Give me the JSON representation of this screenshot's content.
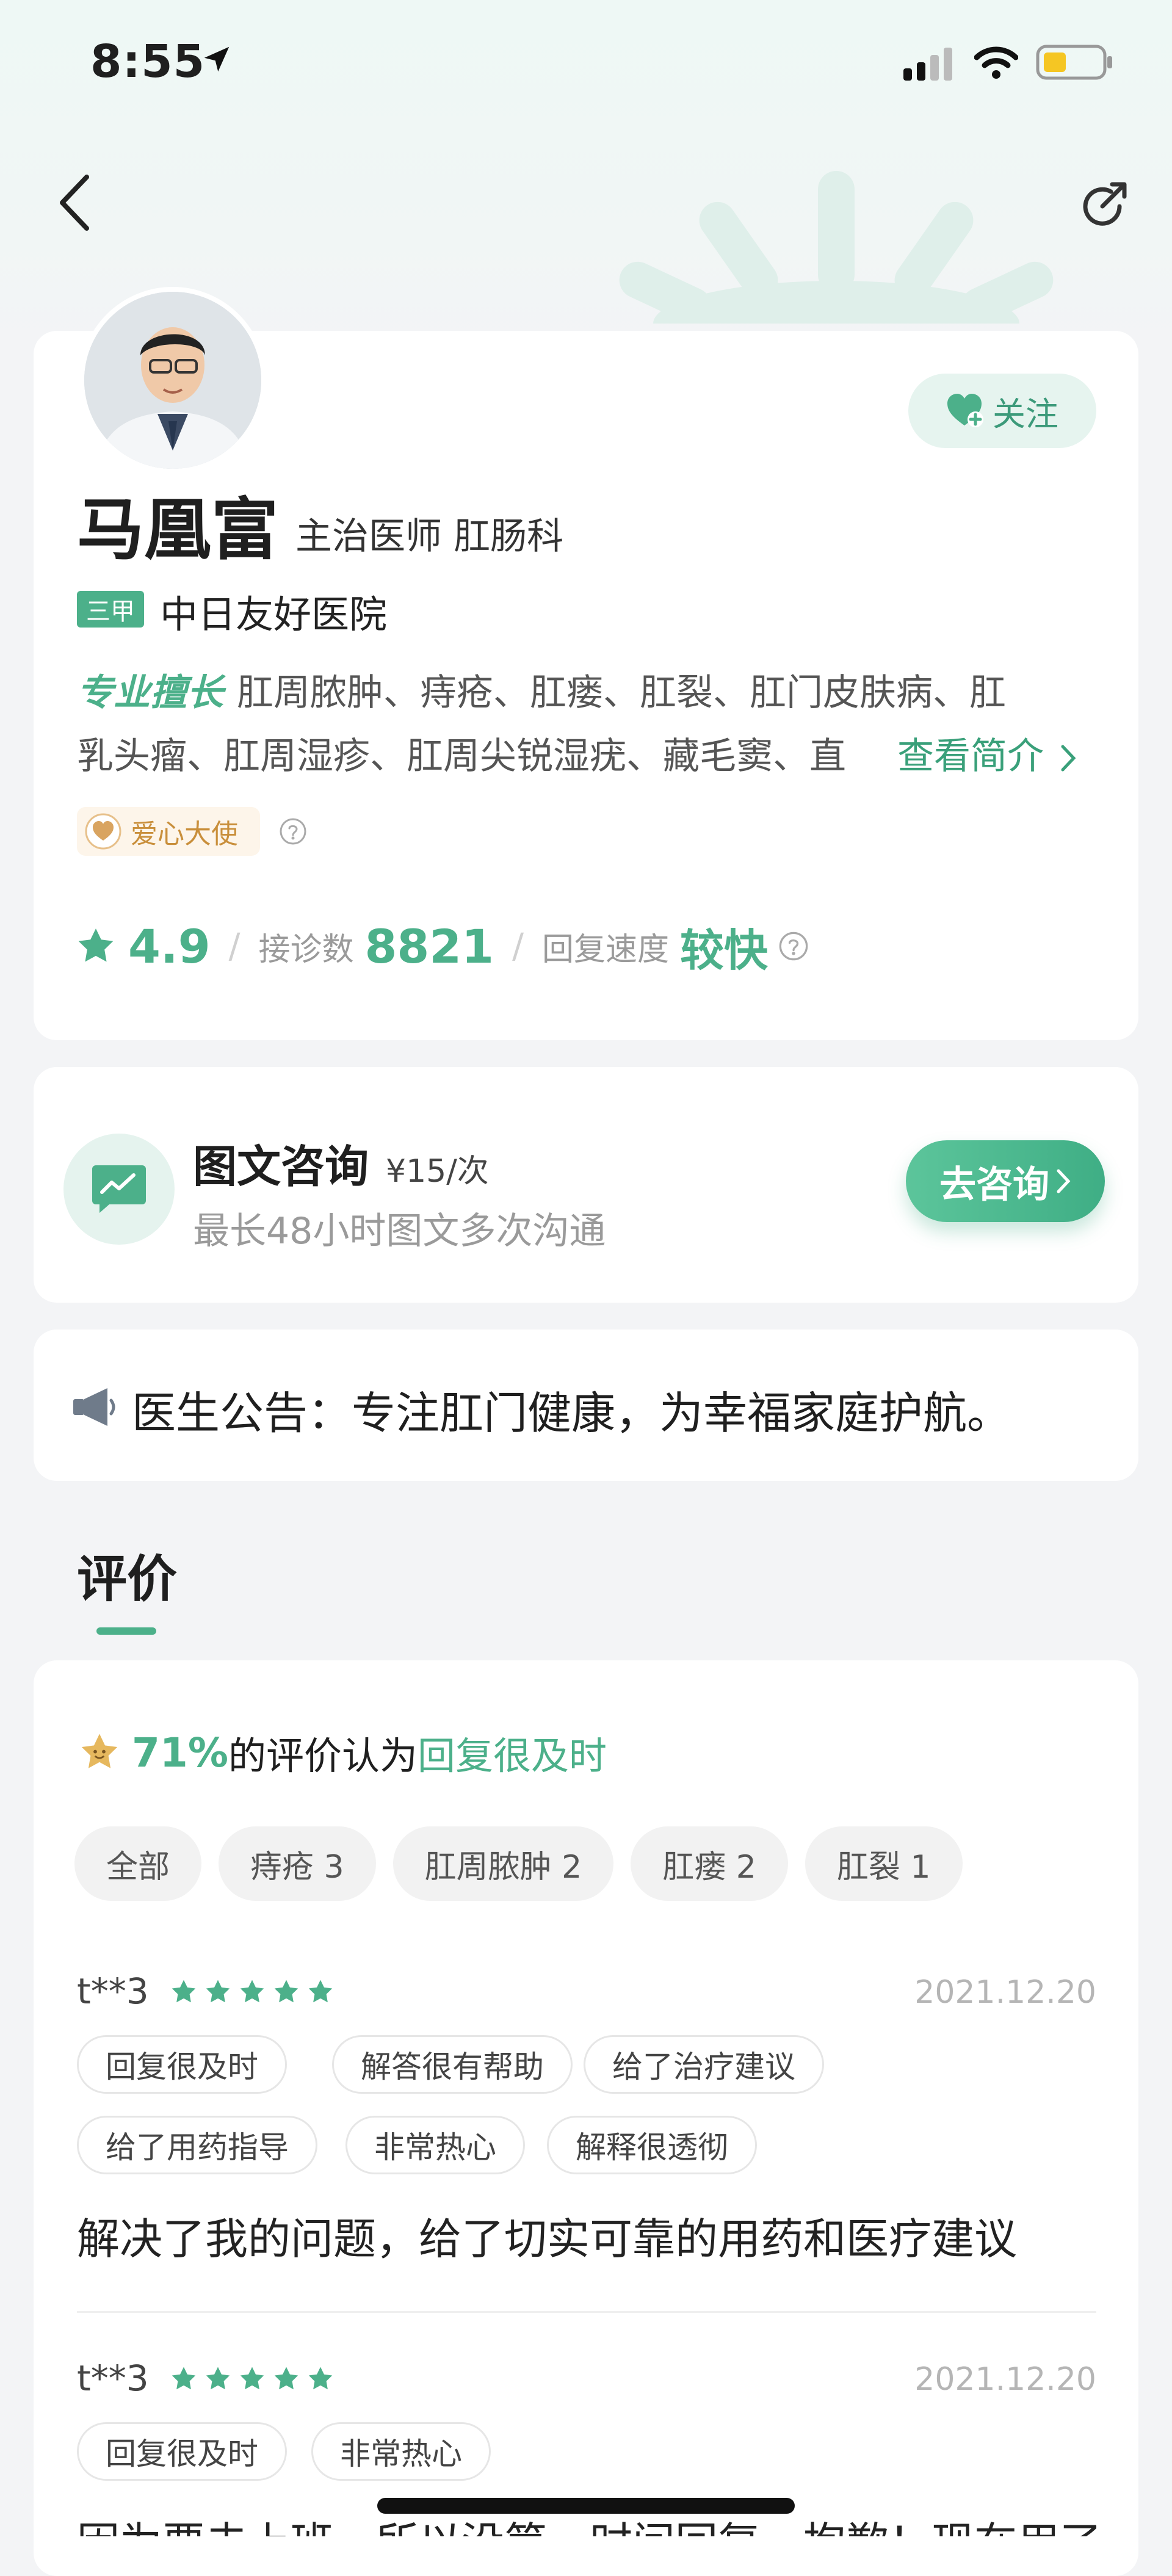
{
  "status_bar": {
    "time": "8:55"
  },
  "doctor": {
    "name": "马凰富",
    "title_dept": "主治医师 肛肠科",
    "hospital_tier": "三甲",
    "hospital": "中日友好医院",
    "follow_label": "关注",
    "specialty_label": "专业擅长",
    "specialty_line1": "肛周脓肿、痔疮、肛瘘、肛裂、肛门皮肤病、肛",
    "specialty_line2": "乳头瘤、肛周湿疹、肛周尖锐湿疣、藏毛窦、直",
    "more_label": "查看简介",
    "badge_label": "爱心大使",
    "stats": {
      "rating": "4.9",
      "visits_label": "接诊数",
      "visits": "8821",
      "speed_label": "回复速度",
      "speed": "较快"
    }
  },
  "consult": {
    "title": "图文咨询",
    "price": "¥15/次",
    "desc": "最长48小时图文多次沟通",
    "button": "去咨询"
  },
  "notice": {
    "text": "医生公告：专注肛门健康，为幸福家庭护航。"
  },
  "reviews": {
    "section_title": "评价",
    "summary_pct": "71%",
    "summary_mid": "的评价认为",
    "summary_tag": "回复很及时",
    "filters": [
      "全部",
      "痔疮 3",
      "肛周脓肿 2",
      "肛瘘 2",
      "肛裂 1"
    ],
    "items": [
      {
        "user": "t**3",
        "stars": 5,
        "date": "2021.12.20",
        "tags": [
          "回复很及时",
          "解答很有帮助",
          "给了治疗建议",
          "给了用药指导",
          "非常热心",
          "解释很透彻"
        ],
        "text": "解决了我的问题，给了切实可靠的用药和医疗建议"
      },
      {
        "user": "t**3",
        "stars": 5,
        "date": "2021.12.20",
        "tags": [
          "回复很及时",
          "非常热心"
        ],
        "text": "因为要去上班，所以没第一时间回复，抱歉！现在用了"
      }
    ]
  },
  "colors": {
    "accent": "#4cb08a",
    "badge_gold": "#c98f3b",
    "background": "#f3f4f6"
  }
}
